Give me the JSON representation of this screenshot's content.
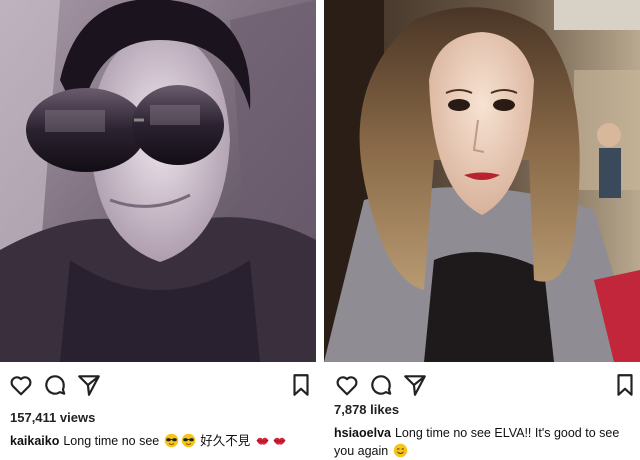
{
  "posts": [
    {
      "stats_text": "157,411 views",
      "username": "kaikaiko",
      "caption_text": "Long time no see",
      "caption_cjk": "好久不見",
      "caption_emojis": [
        "sunglasses-emoji",
        "sunglasses-emoji",
        "kiss-lips-emoji",
        "kiss-lips-emoji"
      ],
      "icons": [
        "heart-icon",
        "comment-icon",
        "share-icon",
        "bookmark-icon"
      ]
    },
    {
      "stats_text": "7,878 likes",
      "username": "hsiaoelva",
      "caption_text": "Long time no see ELVA!! It's good to see you again",
      "caption_emojis": [
        "smile-emoji"
      ],
      "icons": [
        "heart-icon",
        "comment-icon",
        "share-icon",
        "bookmark-icon"
      ]
    }
  ],
  "colors": {
    "icon_stroke": "#222222",
    "text": "#111111",
    "emoji_yellow": "#f5c518",
    "lips_red": "#d4233a"
  }
}
